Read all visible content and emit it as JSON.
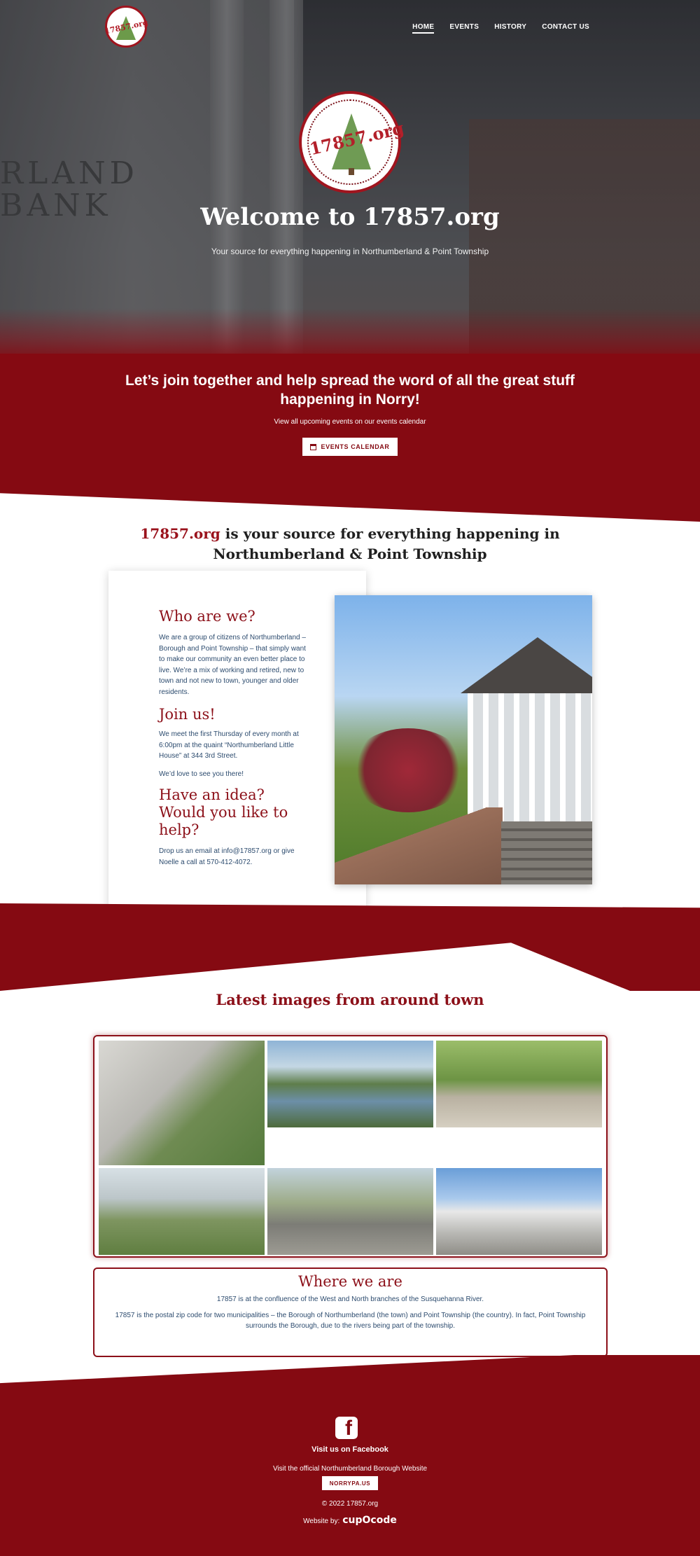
{
  "nav": {
    "logo_text": "17857.org",
    "items": [
      {
        "label": "HOME",
        "active": true
      },
      {
        "label": "EVENTS",
        "active": false
      },
      {
        "label": "HISTORY",
        "active": false
      },
      {
        "label": "CONTACT US",
        "active": false
      }
    ]
  },
  "hero": {
    "logo_text": "17857.org",
    "background_engraving": "RLAND\nBANK",
    "title": "Welcome to 17857.org",
    "subtitle": "Your source for everything happening in Northumberland & Point Township"
  },
  "cta": {
    "heading": "Let’s join together and help spread the word of all the great stuff happening in Norry!",
    "sub": "View all upcoming events on our events calendar",
    "button_label": "EVENTS CALENDAR",
    "button_icon": "calendar-icon"
  },
  "intro": {
    "brand": "17857.org",
    "text": " is your source for everything happening in Northumberland & Point Township"
  },
  "about": {
    "who_title": "Who are we?",
    "who_text": "We are a group of citizens of Northumberland – Borough and Point Township – that simply want to make our community an even better place to live. We’re a mix of working and retired, new to town and not new to town, younger and older residents.",
    "join_title": "Join us!",
    "join_text": "We meet the first Thursday of every month at 6:00pm at the quaint “Northumberland Little House” at 344 3rd Street.",
    "join_text2": "We’d love to see you there!",
    "idea_title": "Have an idea? Would you like to help?",
    "idea_text": "Drop us an email at info@17857.org or give Noelle a call at 570-412-4072."
  },
  "gallery": {
    "title": "Latest images from around town"
  },
  "where": {
    "title": "Where we are",
    "text1": "17857 is at the confluence of the West and North branches of the Susquehanna River.",
    "text2": "17857 is the postal zip code for two municipalities – the Borough of Northumberland (the town) and Point Township (the country). In fact, Point Township surrounds the Borough, due to the rivers being part of the township."
  },
  "footer": {
    "facebook_icon": "facebook-icon",
    "facebook_label": "Visit us on Facebook",
    "borough_text": "Visit the official Northumberland Borough Website",
    "borough_button": "NORRYPA.US",
    "copyright": "© 2022 17857.org",
    "website_by": "Website by:",
    "agency": "cupOcode"
  },
  "colors": {
    "brand_red": "#850a12",
    "heading_red": "#8c1019",
    "body_blue": "#2c4b6e"
  }
}
